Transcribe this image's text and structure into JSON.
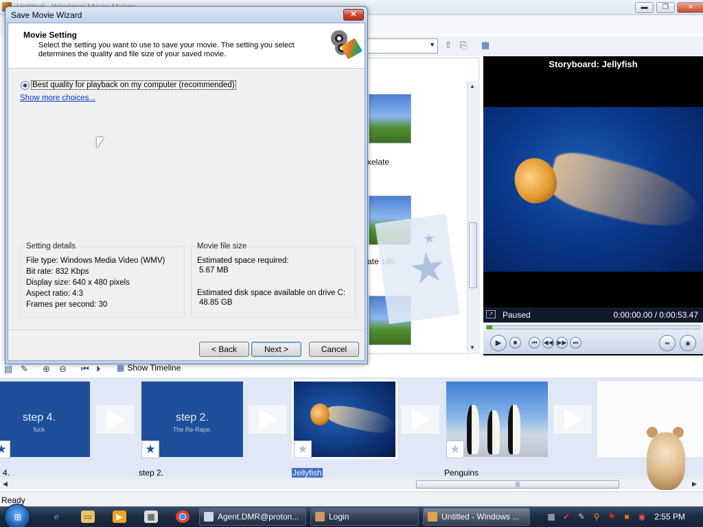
{
  "app": {
    "title_fragment": "Untitled - Windows Movie Maker",
    "window_buttons": {
      "minimize": "▬",
      "maximize": "❐",
      "close": "✕"
    }
  },
  "effects": {
    "items": [
      {
        "label": "xelate"
      },
      {
        "label": "ate 180"
      }
    ]
  },
  "monitor": {
    "title": "Storyboard: Jellyfish",
    "state": "Paused",
    "time": "0:00:00.00 / 0:00:53.47"
  },
  "storyboard_toolbar": {
    "show_timeline": "Show Timeline"
  },
  "storyboard": {
    "clips": [
      {
        "big": "step 4.",
        "small": "fuck",
        "label": "4."
      },
      {
        "big": "step 2.",
        "small": "The Re-Rape.",
        "label": "step 2."
      },
      {
        "label": "Jellyfish"
      },
      {
        "label": "Penguins"
      }
    ]
  },
  "status": {
    "text": "Ready"
  },
  "taskbar": {
    "buttons": [
      {
        "label": "Agent.DMR@proton..."
      },
      {
        "label": "Login"
      },
      {
        "label": "Untitled - Windows ..."
      }
    ],
    "clock": "2:55 PM"
  },
  "dialog": {
    "title": "Save Movie Wizard",
    "close": "✕",
    "heading": "Movie Setting",
    "description": "Select the setting you want to use to save your movie. The setting you select determines the quality and file size of your saved movie.",
    "option_label": "Best quality for playback on my computer (recommended)",
    "show_more": "Show more choices...",
    "setting_details": {
      "title": "Setting details",
      "lines": [
        "File type: Windows Media Video (WMV)",
        "Bit rate: 832 Kbps",
        "Display size: 640 x 480 pixels",
        "Aspect ratio: 4:3",
        "Frames per second: 30"
      ]
    },
    "file_size": {
      "title": "Movie file size",
      "required_label": "Estimated space required:",
      "required_value": "5.67 MB",
      "available_label": "Estimated disk space available on drive C:",
      "available_value": "48.85 GB"
    },
    "buttons": {
      "back": "< Back",
      "next": "Next >",
      "cancel": "Cancel"
    }
  }
}
